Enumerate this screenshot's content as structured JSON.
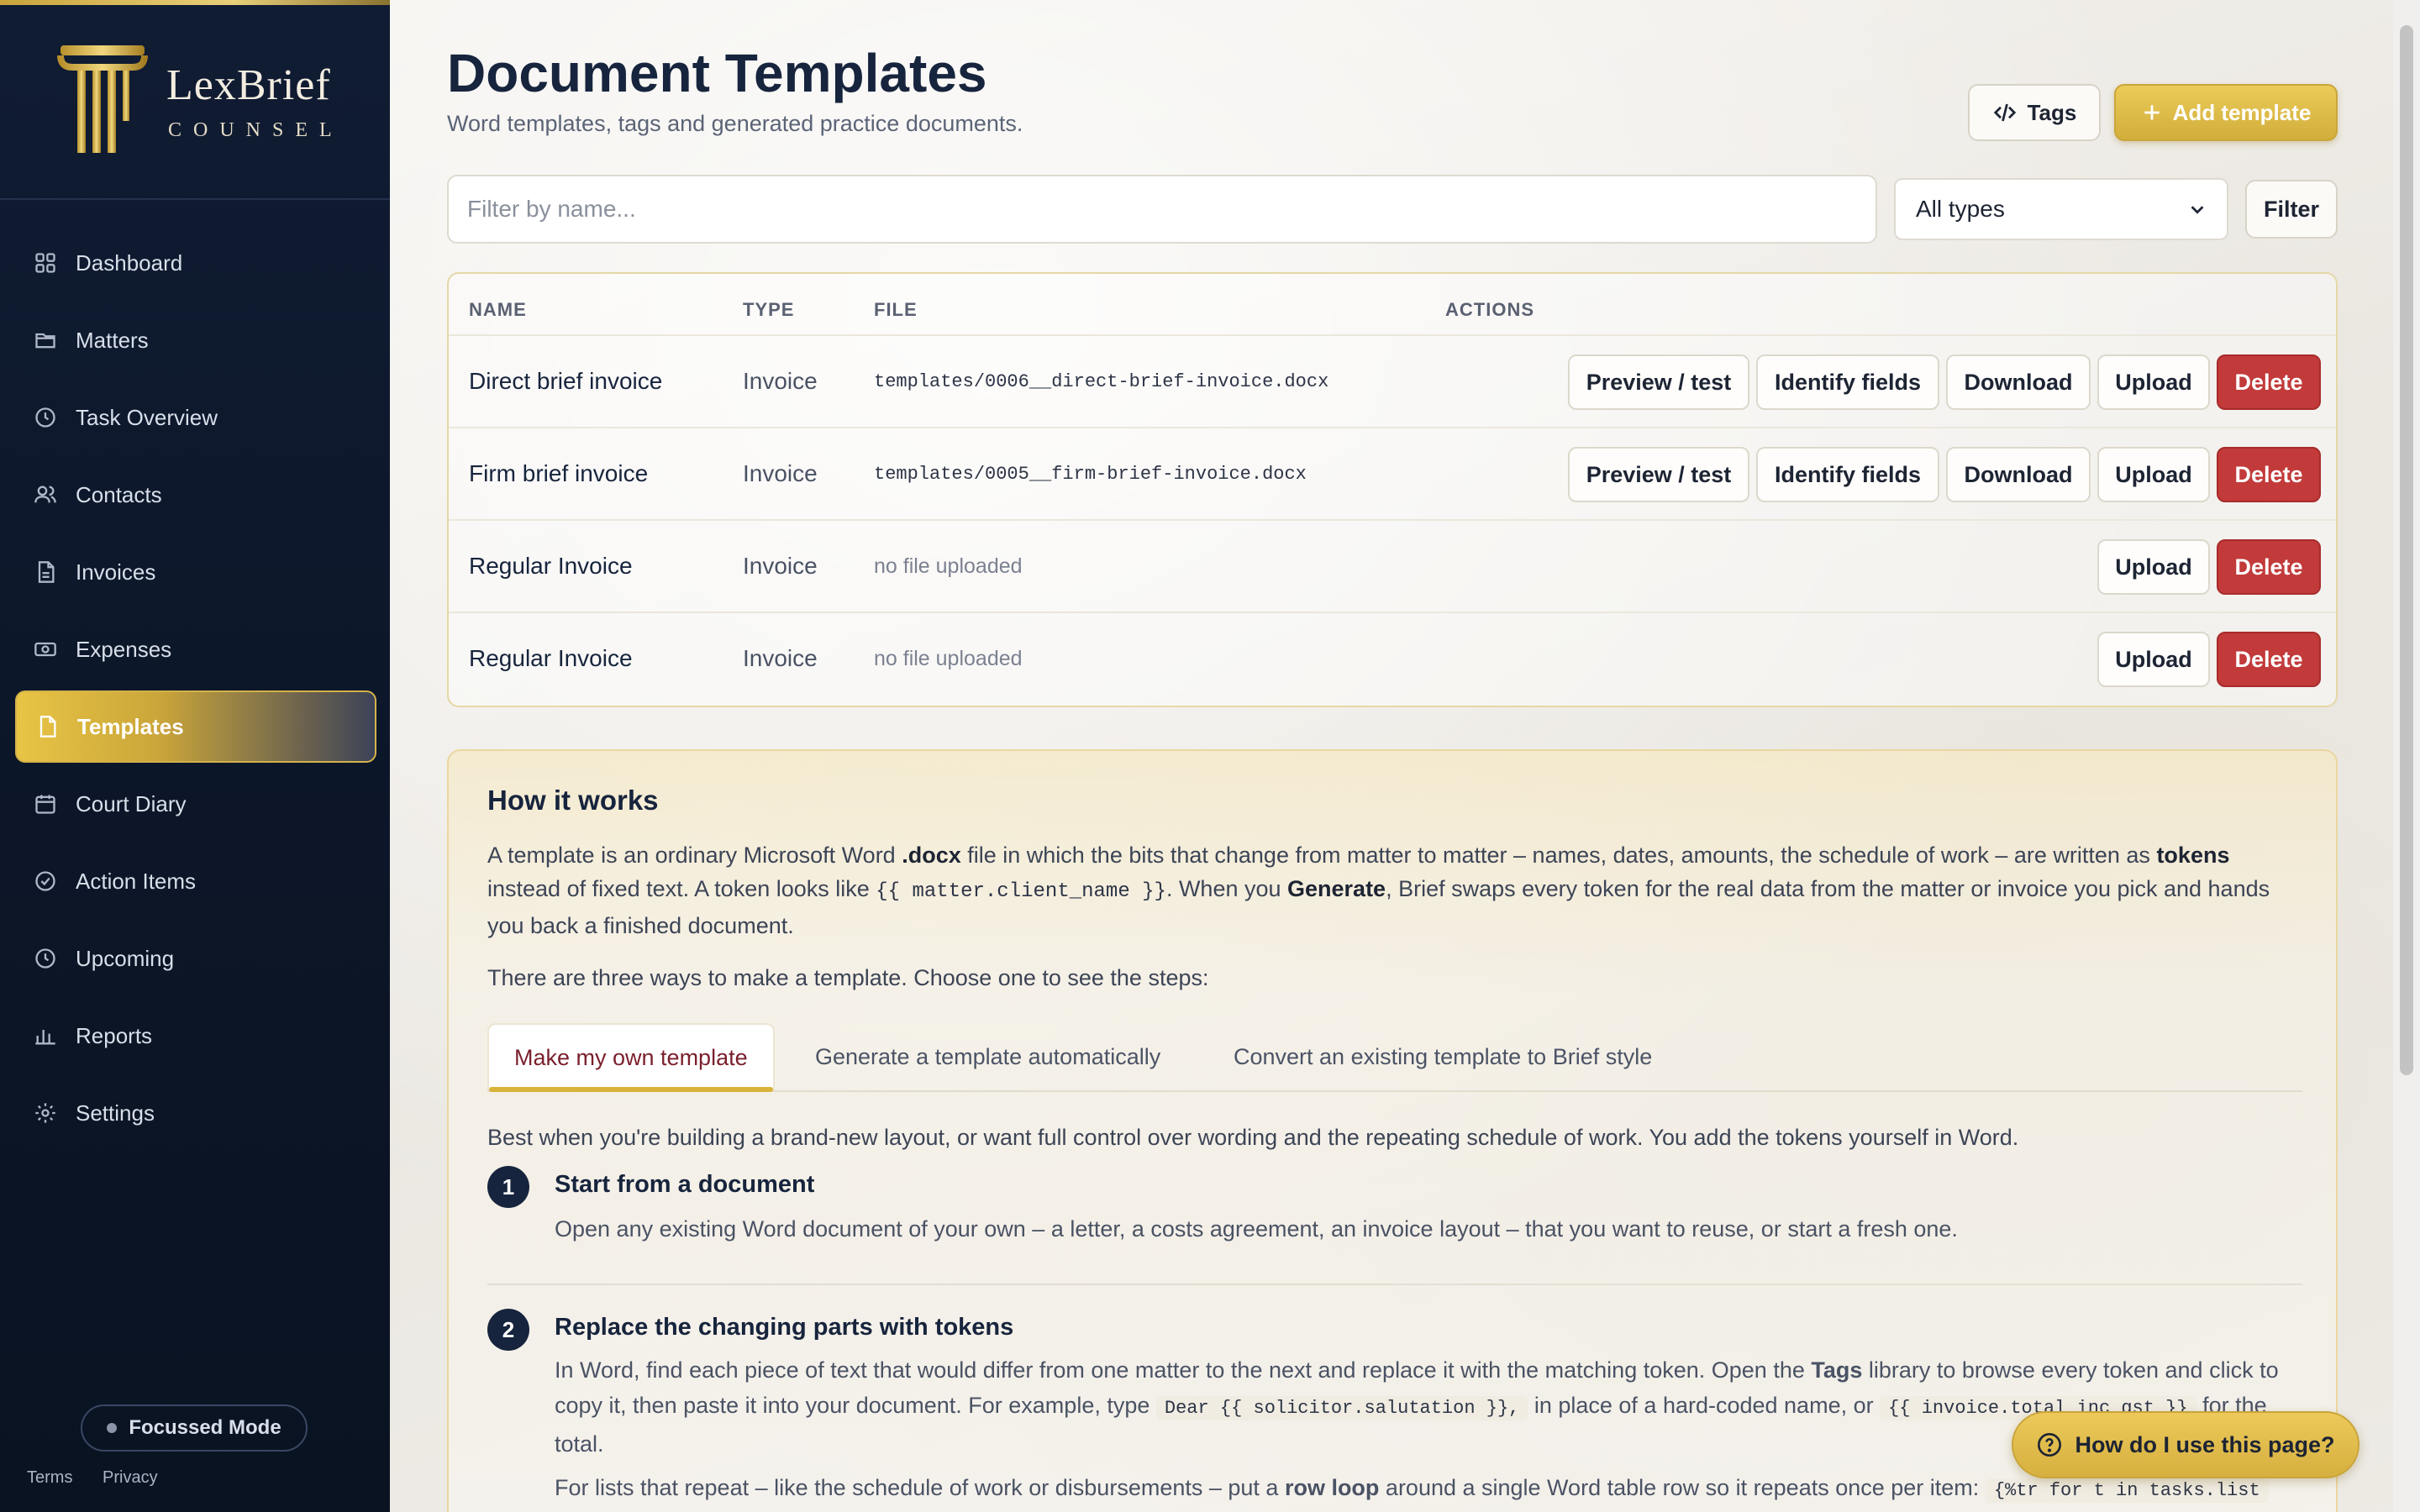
{
  "brand": {
    "name": "LexBrief",
    "sub": "COUNSEL"
  },
  "nav": [
    {
      "label": "Dashboard",
      "icon": "grid-icon"
    },
    {
      "label": "Matters",
      "icon": "folder-icon"
    },
    {
      "label": "Task Overview",
      "icon": "clock-icon"
    },
    {
      "label": "Contacts",
      "icon": "users-icon"
    },
    {
      "label": "Invoices",
      "icon": "file-text-icon"
    },
    {
      "label": "Expenses",
      "icon": "cash-icon"
    },
    {
      "label": "Templates",
      "icon": "file-icon",
      "active": true
    },
    {
      "label": "Court Diary",
      "icon": "calendar-icon"
    },
    {
      "label": "Action Items",
      "icon": "check-circle-icon"
    },
    {
      "label": "Upcoming",
      "icon": "clock-icon"
    },
    {
      "label": "Reports",
      "icon": "bar-chart-icon"
    },
    {
      "label": "Settings",
      "icon": "gear-icon"
    }
  ],
  "focus_mode": "Focussed Mode",
  "footer": {
    "terms": "Terms",
    "privacy": "Privacy"
  },
  "header": {
    "title": "Document Templates",
    "subtitle": "Word templates, tags and generated practice documents.",
    "tags_label": "Tags",
    "add_label": "Add template"
  },
  "filter": {
    "placeholder": "Filter by name...",
    "type_value": "All types",
    "button": "Filter"
  },
  "table": {
    "columns": [
      "NAME",
      "TYPE",
      "FILE",
      "ACTIONS"
    ],
    "rows": [
      {
        "name": "Direct brief invoice",
        "type": "Invoice",
        "file": "templates/0006__direct-brief-invoice.docx"
      },
      {
        "name": "Firm brief invoice",
        "type": "Invoice",
        "file": "templates/0005__firm-brief-invoice.docx"
      },
      {
        "name": "Regular Invoice",
        "type": "Invoice",
        "file": "no file uploaded"
      },
      {
        "name": "Regular Invoice",
        "type": "Invoice",
        "file": "no file uploaded"
      }
    ],
    "actions": {
      "preview": "Preview / test",
      "identify": "Identify fields",
      "download": "Download",
      "upload": "Upload",
      "delete": "Delete"
    }
  },
  "how": {
    "title": "How it works",
    "intro_1": "A template is an ordinary Microsoft Word ",
    "intro_docx": ".docx",
    "intro_2": " file in which the bits that change from matter to matter – names, dates, amounts, the schedule of work – are written as ",
    "intro_tokens": "tokens",
    "intro_3": " instead of fixed text. A token looks like ",
    "intro_code": "{{ matter.client_name }}",
    "intro_4": ". When you ",
    "intro_generate": "Generate",
    "intro_5": ", Brief swaps every token for the real data from the matter or invoice you pick and hands you back a finished document.",
    "ways": "There are three ways to make a template. Choose one to see the steps:",
    "tabs": [
      "Make my own template",
      "Generate a template automatically",
      "Convert an existing template to Brief style"
    ],
    "tab_desc": "Best when you're building a brand-new layout, or want full control over wording and the repeating schedule of work. You add the tokens yourself in Word.",
    "step1_title": "Start from a document",
    "step1_text": "Open any existing Word document of your own – a letter, a costs agreement, an invoice layout – that you want to reuse, or start a fresh one.",
    "step2_title": "Replace the changing parts with tokens",
    "step2_a": "In Word, find each piece of text that would differ from one matter to the next and replace it with the matching token. Open the ",
    "step2_tags": "Tags",
    "step2_b": " library to browse every token and click to copy it, then paste it into your document. For example, type ",
    "step2_code1": "Dear {{ solicitor.salutation }},",
    "step2_c": " in place of a hard-coded name, or ",
    "step2_code2": "{{ invoice.total_inc_gst }}",
    "step2_d": " for the total.",
    "step2_e": "For lists that repeat – like the schedule of work or disbursements – put a ",
    "step2_rowloop": "row loop",
    "step2_f": " around a single Word table row so it repeats once per item: ",
    "step2_code3": "{%tr for t in tasks.list"
  },
  "help": "How do I use this page?"
}
